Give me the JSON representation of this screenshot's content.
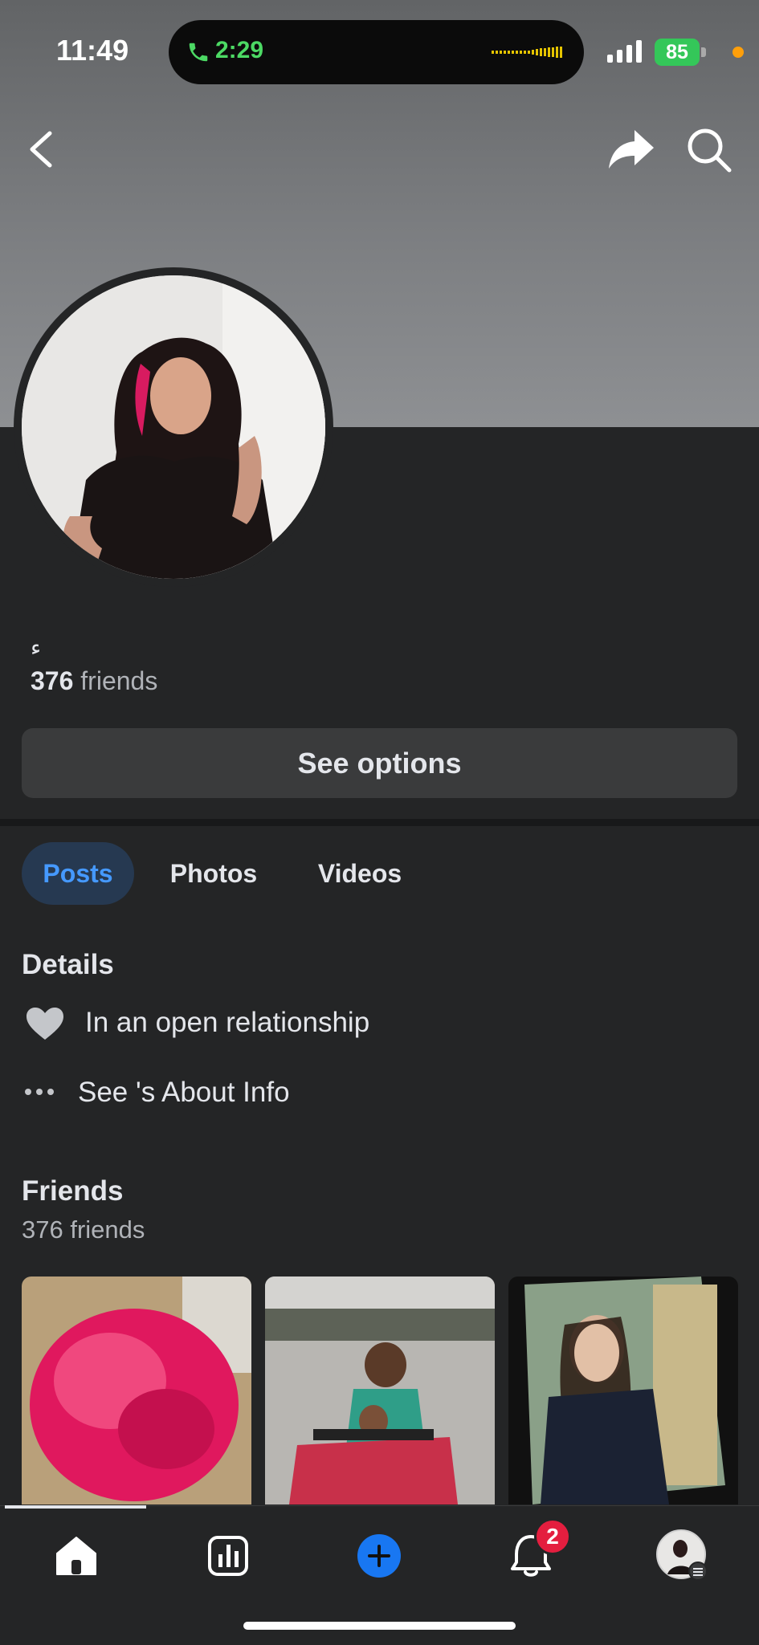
{
  "status_bar": {
    "time": "11:49",
    "call_time": "2:29",
    "battery": "85",
    "call_color": "#4cd964",
    "battery_color": "#34c759",
    "indicator_color": "#ff9f0a"
  },
  "header": {
    "back_icon": "chevron-left-icon",
    "share_icon": "share-arrow-icon",
    "search_icon": "search-icon"
  },
  "profile": {
    "name": "ء",
    "friends_count": "376",
    "friends_suffix": "friends",
    "options_label": "See options"
  },
  "tabs": [
    {
      "label": "Posts",
      "active": true
    },
    {
      "label": "Photos",
      "active": false
    },
    {
      "label": "Videos",
      "active": false
    }
  ],
  "details": {
    "heading": "Details",
    "relationship": "In an open relationship",
    "about_prefix": "See",
    "about_suffix": "'s About Info"
  },
  "friends": {
    "heading": "Friends",
    "count_label": "376 friends"
  },
  "bottom_nav": {
    "items": [
      "home-icon",
      "dashboard-icon",
      "create-icon",
      "notifications-icon",
      "profile-menu-icon"
    ],
    "notification_badge": "2",
    "accent": "#1877f2"
  }
}
